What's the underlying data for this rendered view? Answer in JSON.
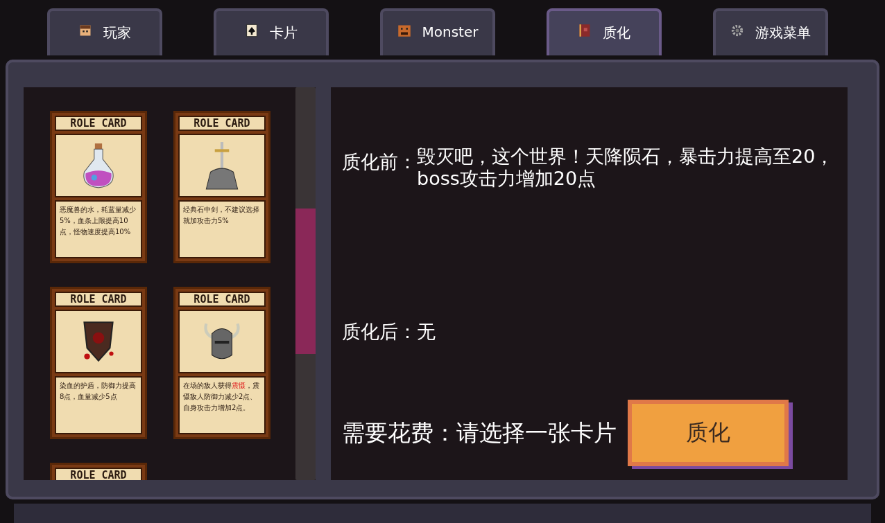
{
  "tabs": [
    {
      "label": "玩家",
      "selected": false
    },
    {
      "label": "卡片",
      "selected": false
    },
    {
      "label": "Monster",
      "selected": false
    },
    {
      "label": "质化",
      "selected": true
    },
    {
      "label": "游戏菜单",
      "selected": false
    }
  ],
  "cards": [
    {
      "header": "ROLE CARD",
      "kind": "potion",
      "parts": [
        {
          "text": "恶魔兽的水，耗蓝量减少5%，血条上限提高10点，怪物速度提高10%",
          "highlight": false
        }
      ]
    },
    {
      "header": "ROLE CARD",
      "kind": "sword",
      "parts": [
        {
          "text": "经典石中剑，不建议选择就加攻击力5%",
          "highlight": false
        }
      ]
    },
    {
      "header": "ROLE CARD",
      "kind": "shield",
      "parts": [
        {
          "text": "染血的护盾，防御力提高8点，血量减少5点",
          "highlight": false
        }
      ]
    },
    {
      "header": "ROLE CARD",
      "kind": "helmet",
      "parts": [
        {
          "text": "在场的敌人获得",
          "highlight": false
        },
        {
          "text": "震慑",
          "highlight": true
        },
        {
          "text": "，震慑敌人防御力减少2点、自身攻击力增加2点。",
          "highlight": false
        }
      ]
    },
    {
      "header": "ROLE CARD"
    }
  ],
  "before": {
    "label": "质化前：",
    "text": "毁灭吧，这个世界！天降陨石，暴击力提高至20，boss攻击力增加20点"
  },
  "after": {
    "label": "质化后：",
    "text": "无"
  },
  "cost": {
    "label": "需要花费：",
    "text": "请选择一张卡片"
  },
  "button": "质化"
}
